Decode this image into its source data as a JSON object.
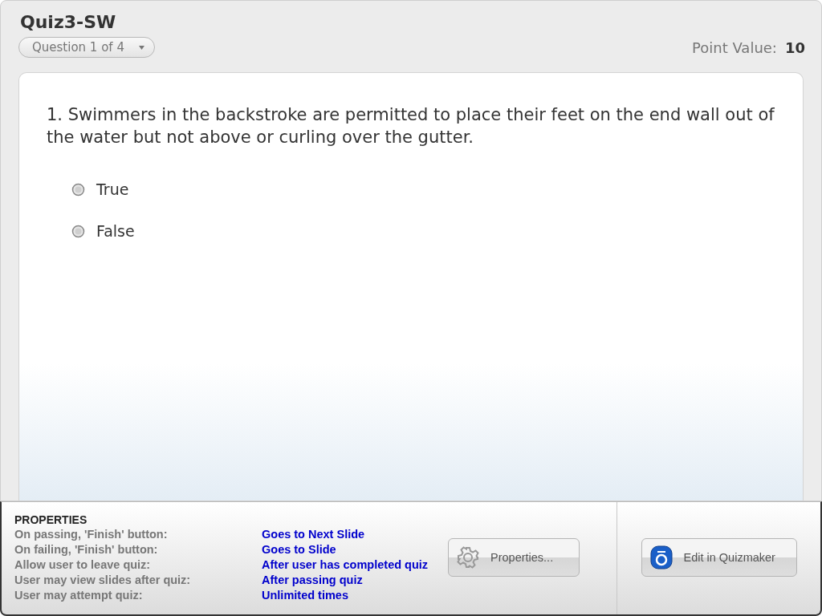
{
  "quiz": {
    "title": "Quiz3-SW",
    "question_selector": "Question 1 of 4",
    "point_value_label": "Point Value:",
    "point_value": "10"
  },
  "question": {
    "text": "1.  Swimmers in the backstroke are permitted to place their feet on the end wall out of the water but not above or curling over the gutter.",
    "options": [
      {
        "label": "True",
        "selected": false
      },
      {
        "label": "False",
        "selected": false
      }
    ]
  },
  "properties": {
    "heading": "PROPERTIES",
    "rows": [
      {
        "label": "On passing, 'Finish' button:",
        "value": "Goes to Next Slide"
      },
      {
        "label": "On failing, 'Finish' button:",
        "value": "Goes to Slide"
      },
      {
        "label": "Allow user to leave quiz:",
        "value": "After user has completed quiz"
      },
      {
        "label": "User may view slides after quiz:",
        "value": "After passing quiz"
      },
      {
        "label": "User may attempt quiz:",
        "value": "Unlimited times"
      }
    ]
  },
  "buttons": {
    "properties": "Properties...",
    "edit": "Edit in Quizmaker"
  }
}
